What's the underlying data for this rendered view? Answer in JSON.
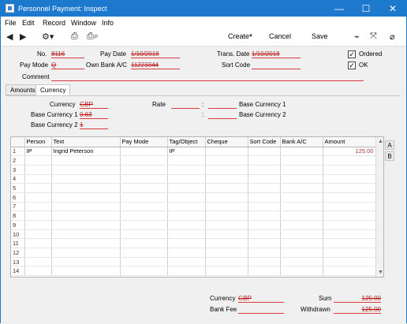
{
  "window": {
    "title": "Personnel Payment: Inspect",
    "controls": [
      "—",
      "☐",
      "✕"
    ]
  },
  "menu": [
    "File",
    "Edit",
    "Record",
    "Window",
    "Info"
  ],
  "toolbar": {
    "create_label": "Create",
    "cancel_label": "Cancel",
    "save_label": "Save",
    "icons": [
      "back-icon",
      "forward-icon",
      "settings-icon",
      "print-icon",
      "print-preview-icon",
      "chart-icon",
      "expand-icon",
      "attachment-icon"
    ]
  },
  "header": {
    "no_label": "No.",
    "no_value": "8116",
    "pay_date_label": "Pay Date",
    "pay_date_value": "1/10/2018",
    "trans_date_label": "Trans. Date",
    "trans_date_value": "1/10/2018",
    "ordered_label": "Ordered",
    "ordered_checked": true,
    "pay_mode_label": "Pay Mode",
    "pay_mode_value": "Q",
    "own_bank_label": "Own Bank A/C",
    "own_bank_value": "11223344",
    "sort_code_label": "Sort Code",
    "sort_code_value": "",
    "ok_label": "OK",
    "ok_checked": true,
    "comment_label": "Comment",
    "comment_value": ""
  },
  "tabs": [
    "Amounts",
    "Currency"
  ],
  "active_tab": "Currency",
  "currency_tab": {
    "currency_label": "Currency",
    "currency_value": "GBP",
    "rate_label": "Rate",
    "rate_value": "",
    "base_currency1_label": "Base Currency 1",
    "base_currency1_value": "0.63",
    "base_currency2_label": "Base Currency 2",
    "base_currency2_value": "1",
    "rate_right1_label": "Base Currency 1",
    "rate_right2_label": "Base Currency 2",
    "colon": ":"
  },
  "grid": {
    "columns": [
      "",
      "Person",
      "Text",
      "Pay Mode",
      "Tag/Object",
      "Cheque",
      "Sort Code",
      "Bank A/C",
      "Amount"
    ],
    "rows": [
      {
        "n": "1",
        "person": "IP",
        "text": "Ingrid Peterson",
        "paymode": "",
        "tag": "IP",
        "cheque": "",
        "sort": "",
        "bank": "",
        "amount": "125.00"
      },
      {
        "n": "2",
        "person": "",
        "text": "",
        "paymode": "",
        "tag": "",
        "cheque": "",
        "sort": "",
        "bank": "",
        "amount": ""
      },
      {
        "n": "3",
        "person": "",
        "text": "",
        "paymode": "",
        "tag": "",
        "cheque": "",
        "sort": "",
        "bank": "",
        "amount": ""
      },
      {
        "n": "4",
        "person": "",
        "text": "",
        "paymode": "",
        "tag": "",
        "cheque": "",
        "sort": "",
        "bank": "",
        "amount": ""
      },
      {
        "n": "5",
        "person": "",
        "text": "",
        "paymode": "",
        "tag": "",
        "cheque": "",
        "sort": "",
        "bank": "",
        "amount": ""
      },
      {
        "n": "6",
        "person": "",
        "text": "",
        "paymode": "",
        "tag": "",
        "cheque": "",
        "sort": "",
        "bank": "",
        "amount": ""
      },
      {
        "n": "7",
        "person": "",
        "text": "",
        "paymode": "",
        "tag": "",
        "cheque": "",
        "sort": "",
        "bank": "",
        "amount": ""
      },
      {
        "n": "8",
        "person": "",
        "text": "",
        "paymode": "",
        "tag": "",
        "cheque": "",
        "sort": "",
        "bank": "",
        "amount": ""
      },
      {
        "n": "9",
        "person": "",
        "text": "",
        "paymode": "",
        "tag": "",
        "cheque": "",
        "sort": "",
        "bank": "",
        "amount": ""
      },
      {
        "n": "10",
        "person": "",
        "text": "",
        "paymode": "",
        "tag": "",
        "cheque": "",
        "sort": "",
        "bank": "",
        "amount": ""
      },
      {
        "n": "11",
        "person": "",
        "text": "",
        "paymode": "",
        "tag": "",
        "cheque": "",
        "sort": "",
        "bank": "",
        "amount": ""
      },
      {
        "n": "12",
        "person": "",
        "text": "",
        "paymode": "",
        "tag": "",
        "cheque": "",
        "sort": "",
        "bank": "",
        "amount": ""
      },
      {
        "n": "13",
        "person": "",
        "text": "",
        "paymode": "",
        "tag": "",
        "cheque": "",
        "sort": "",
        "bank": "",
        "amount": ""
      },
      {
        "n": "14",
        "person": "",
        "text": "",
        "paymode": "",
        "tag": "",
        "cheque": "",
        "sort": "",
        "bank": "",
        "amount": ""
      }
    ],
    "side_buttons": [
      "A",
      "B"
    ]
  },
  "footer": {
    "currency_label": "Currency",
    "currency_value": "GBP",
    "bank_fee_label": "Bank Fee",
    "bank_fee_value": "",
    "sum_label": "Sum",
    "sum_value": "125.00",
    "withdrawn_label": "Withdrawn",
    "withdrawn_value": "125.00"
  },
  "colors": {
    "titlebar": "#1c79cd",
    "invalid_line": "#d83b3b"
  }
}
